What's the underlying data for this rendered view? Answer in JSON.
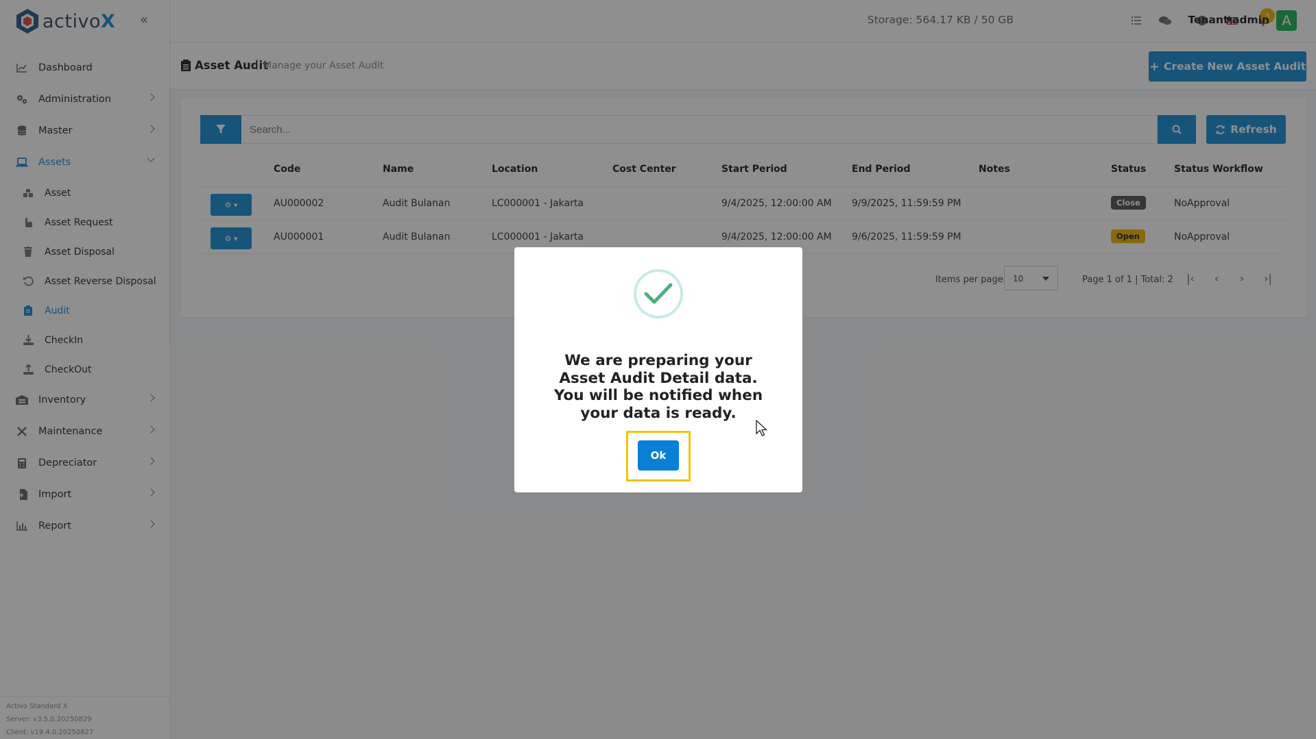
{
  "app": {
    "logo_text": "activo",
    "logo_x": "X",
    "storage": "Storage: 564.17 KB / 50 GB",
    "notifications_count": "3",
    "user": "Tenant\\admin",
    "avatar_letter": "A"
  },
  "sidebar": {
    "items": [
      {
        "label": "Dashboard",
        "icon": "chart-line-icon"
      },
      {
        "label": "Administration",
        "icon": "gears-icon"
      },
      {
        "label": "Master",
        "icon": "database-icon"
      },
      {
        "label": "Assets",
        "icon": "laptop-icon"
      },
      {
        "label": "Inventory",
        "icon": "warehouse-icon"
      },
      {
        "label": "Maintenance",
        "icon": "tools-icon"
      },
      {
        "label": "Depreciator",
        "icon": "calculator-icon"
      },
      {
        "label": "Import",
        "icon": "file-import-icon"
      },
      {
        "label": "Report",
        "icon": "chart-bar-icon"
      }
    ],
    "assets_sub": [
      {
        "label": "Asset"
      },
      {
        "label": "Asset Request"
      },
      {
        "label": "Asset Disposal"
      },
      {
        "label": "Asset Reverse Disposal"
      },
      {
        "label": "Audit"
      },
      {
        "label": "CheckIn"
      },
      {
        "label": "CheckOut"
      }
    ],
    "version": {
      "product": "Activo Standard X",
      "server": "Server: v3.5.0.20250829",
      "client": "Client: v19.4.0.20250827"
    }
  },
  "page": {
    "title": "Asset Audit",
    "subtitle": "Manage your Asset Audit",
    "create_button": "Create New Asset Audit"
  },
  "toolbar": {
    "search_placeholder": "Search...",
    "refresh_label": "Refresh"
  },
  "table": {
    "headers": [
      "Code",
      "Name",
      "Location",
      "Cost Center",
      "Start Period",
      "End Period",
      "Notes",
      "Status",
      "Status Workflow"
    ],
    "rows": [
      {
        "code": "AU000002",
        "name": "Audit Bulanan",
        "location": "LC000001 - Jakarta",
        "cost_center": "",
        "start": "9/4/2025, 12:00:00 AM",
        "end": "9/9/2025, 11:59:59 PM",
        "notes": "",
        "status": "Close",
        "workflow": "NoApproval"
      },
      {
        "code": "AU000001",
        "name": "Audit Bulanan",
        "location": "LC000001 - Jakarta",
        "cost_center": "",
        "start": "9/4/2025, 12:00:00 AM",
        "end": "9/6/2025, 11:59:59 PM",
        "notes": "",
        "status": "Open",
        "workflow": "NoApproval"
      }
    ]
  },
  "pager": {
    "items_per_page_label": "Items per page",
    "items_per_page": "10",
    "info": "Page 1 of 1 | Total: 2"
  },
  "modal": {
    "message": "We are preparing your Asset Audit Detail data. You will be notified when your data is ready.",
    "ok_label": "Ok"
  },
  "colors": {
    "primary": "#1a8fd6",
    "success": "#4caf7d",
    "warning": "#f5b400"
  }
}
